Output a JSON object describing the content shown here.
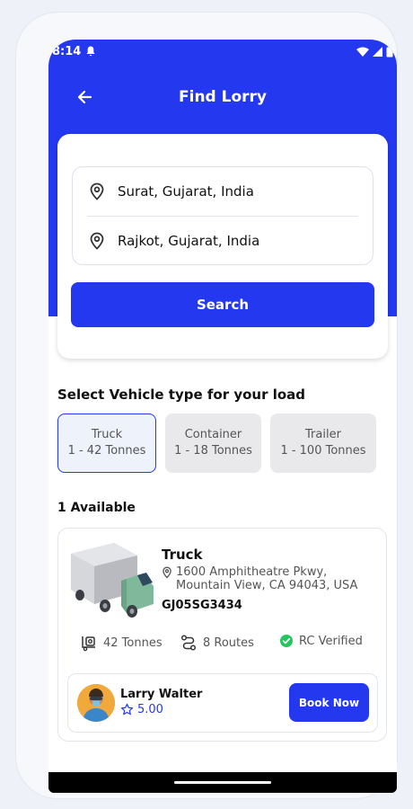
{
  "status_bar": {
    "time": "8:14"
  },
  "header": {
    "title": "Find Lorry"
  },
  "search": {
    "origin": "Surat, Gujarat, India",
    "destination": "Rajkot, Gujarat, India",
    "button_label": "Search"
  },
  "vehicle_section": {
    "title": "Select Vehicle type for your load",
    "types": [
      {
        "name": "Truck",
        "capacity": "1 - 42 Tonnes",
        "selected": true
      },
      {
        "name": "Container",
        "capacity": "1 - 18 Tonnes",
        "selected": false
      },
      {
        "name": "Trailer",
        "capacity": "1 - 100 Tonnes",
        "selected": false
      }
    ]
  },
  "results": {
    "count_label": "1 Available",
    "items": [
      {
        "vehicle": "Truck",
        "address_line1": "1600 Amphitheatre Pkwy,",
        "address_line2": "Mountain View, CA 94043, USA",
        "plate": "GJ05SG3434",
        "capacity": "42 Tonnes",
        "routes": "8 Routes",
        "verification": "RC Verified",
        "owner": {
          "name": "Larry Walter",
          "rating": "5.00"
        },
        "book_label": "Book Now"
      }
    ]
  },
  "colors": {
    "primary": "#2438f0",
    "verified": "#22c55e"
  }
}
